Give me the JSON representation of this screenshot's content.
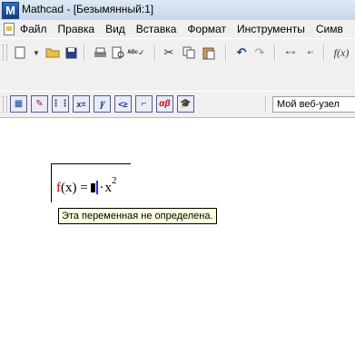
{
  "window": {
    "title": "Mathcad - [Безымянный:1]",
    "logo_letter": "M"
  },
  "menu": {
    "items": [
      "Файл",
      "Правка",
      "Вид",
      "Вставка",
      "Формат",
      "Инструменты",
      "Симв"
    ]
  },
  "toolbar": {
    "icons": [
      "new-icon",
      "open-icon",
      "save-icon",
      "print-icon",
      "print-preview-icon",
      "spell-check-icon",
      "cut-icon",
      "copy-icon",
      "paste-icon",
      "undo-icon",
      "redo-icon",
      "align-top-icon",
      "align-down-icon",
      "insert-function-icon"
    ],
    "fx_label": "f(x)"
  },
  "palette_toolbar": {
    "buttons": [
      "calculator-palette",
      "graph-palette",
      "matrix-palette",
      "evaluation-palette",
      "calculus-palette",
      "boolean-palette",
      "programming-palette",
      "greek-palette",
      "symbolic-palette"
    ],
    "web_dropdown": "Мой веб-узел"
  },
  "worksheet": {
    "function_name": "f",
    "argument": "(x)",
    "equals": "=",
    "variable": "x",
    "exponent": "2",
    "tooltip": "Эта переменная не определена."
  }
}
